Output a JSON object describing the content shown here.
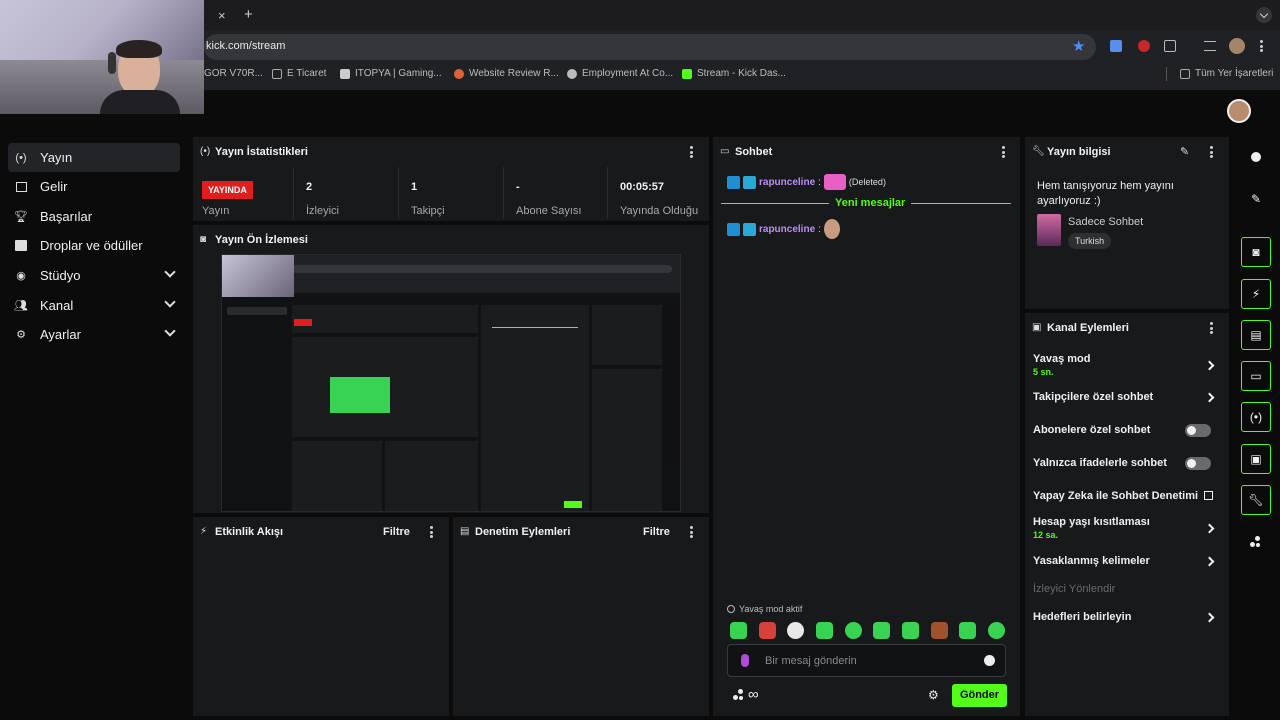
{
  "browser": {
    "url": "kick.com/stream",
    "new_tab_symbol": "+",
    "close_tab_symbol": "×",
    "bookmarks": [
      {
        "label": "GOR V70R...",
        "color": "#888888"
      },
      {
        "label": "E Ticaret",
        "color": "#888888"
      },
      {
        "label": "ITOPYA | Gaming...",
        "color": "#cccccc"
      },
      {
        "label": "Website Review R...",
        "color": "#e0603a"
      },
      {
        "label": "Employment At Co...",
        "color": "#bbbbbb"
      },
      {
        "label": "Stream - Kick Das...",
        "color": "#53fc18"
      }
    ],
    "all_bookmarks": "Tüm Yer İşaretleri"
  },
  "brand": {
    "accent": "#53fc18",
    "live_red": "#e01e1e"
  },
  "sidebar": {
    "items": [
      {
        "label": "Yayın",
        "icon": "broadcast-icon",
        "active": true
      },
      {
        "label": "Gelir",
        "icon": "chart-icon"
      },
      {
        "label": "Başarılar",
        "icon": "trophy-icon"
      },
      {
        "label": "Droplar ve ödüller",
        "icon": "gift-icon"
      },
      {
        "label": "Stüdyo",
        "icon": "studio-icon",
        "expandable": true
      },
      {
        "label": "Kanal",
        "icon": "users-icon",
        "expandable": true
      },
      {
        "label": "Ayarlar",
        "icon": "gear-icon",
        "expandable": true
      }
    ]
  },
  "stats": {
    "title": "Yayın İstatistikleri",
    "live_badge": "YAYINDA",
    "live_label": "Yayın",
    "items": [
      {
        "value": "2",
        "label": "İzleyici"
      },
      {
        "value": "1",
        "label": "Takipçi"
      },
      {
        "value": "-",
        "label": "Abone Sayısı"
      },
      {
        "value": "00:05:57",
        "label": "Yayında Olduğu"
      }
    ]
  },
  "preview": {
    "title": "Yayın Ön İzlemesi"
  },
  "activity": {
    "title": "Etkinlik Akışı",
    "filter": "Filtre"
  },
  "moderation": {
    "title": "Denetim Eylemleri",
    "filter": "Filtre"
  },
  "chat": {
    "title": "Sohbet",
    "messages": [
      {
        "user": "rapunceline",
        "text": "(Deleted)"
      },
      {
        "user": "rapunceline",
        "text": ""
      }
    ],
    "new_messages": "Yeni mesajlar",
    "slow_mode": "Yavaş mod aktif",
    "placeholder": "Bir mesaj gönderin",
    "send": "Gönder"
  },
  "stream_info": {
    "title": "Yayın bilgisi",
    "stream_title": "Hem tanışıyoruz hem yayını ayarlıyoruz :)",
    "category": "Sadece Sohbet",
    "tag": "Turkish"
  },
  "channel_actions": {
    "title": "Kanal Eylemleri",
    "items": [
      {
        "label": "Yavaş mod",
        "sub": "5 sn.",
        "control": "chevron"
      },
      {
        "label": "Takipçilere özel sohbet",
        "control": "chevron"
      },
      {
        "label": "Abonelere özel sohbet",
        "control": "toggle"
      },
      {
        "label": "Yalnızca ifadelerle sohbet",
        "control": "toggle"
      },
      {
        "label": "Yapay Zeka ile Sohbet Denetimi",
        "control": "external"
      },
      {
        "label": "Hesap yaşı kısıtlaması",
        "sub": "12 sa.",
        "control": "chevron"
      },
      {
        "label": "Yasaklanmış kelimeler",
        "control": "chevron"
      },
      {
        "label": "İzleyici Yönlendir",
        "control": "none",
        "disabled": true
      },
      {
        "label": "Hedefleri belirleyin",
        "control": "chevron"
      }
    ]
  },
  "right_rail": [
    "info-icon",
    "pencil-icon",
    "camera-icon",
    "bolt-icon",
    "document-icon",
    "chat-icon",
    "broadcast-icon",
    "layout-icon",
    "wrench-icon",
    "dots-icon"
  ]
}
